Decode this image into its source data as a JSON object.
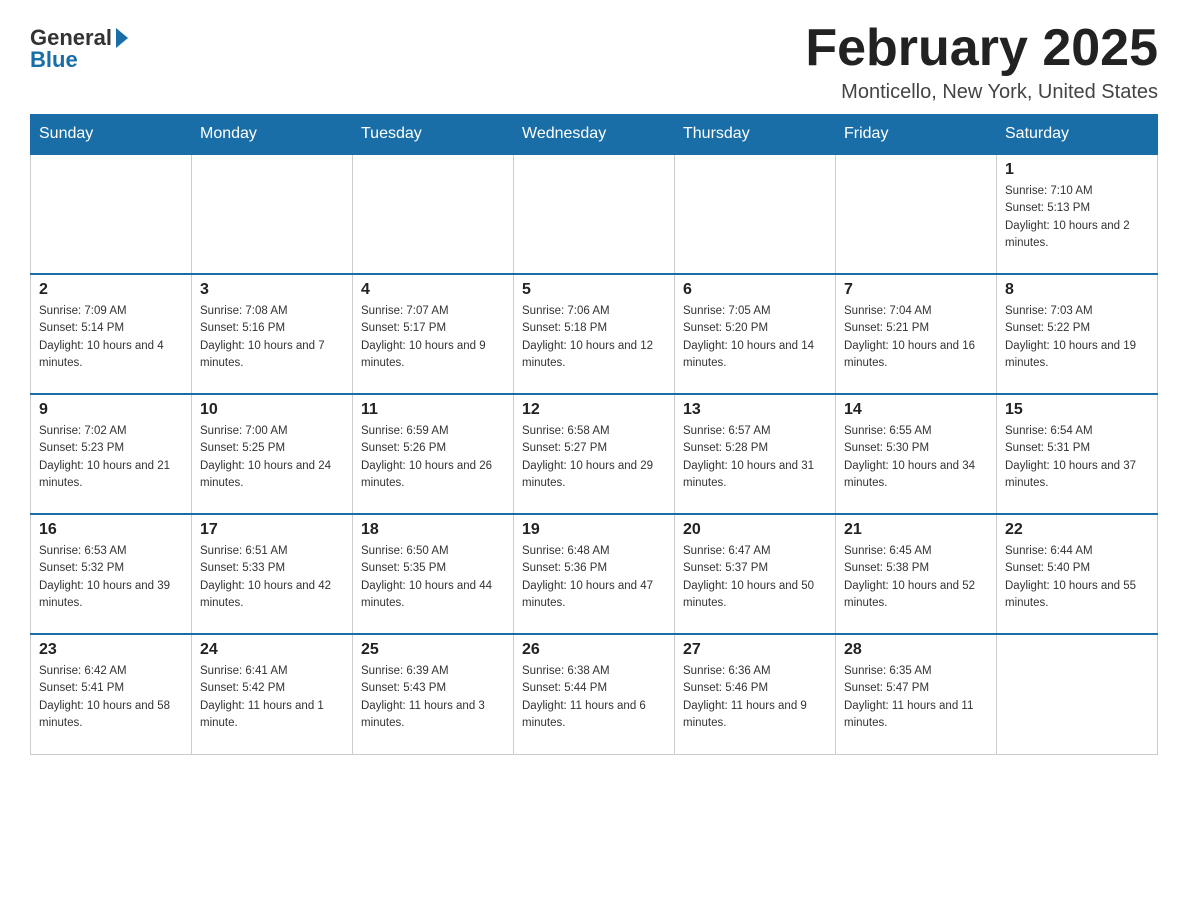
{
  "header": {
    "logo_general": "General",
    "logo_blue": "Blue",
    "title": "February 2025",
    "location": "Monticello, New York, United States"
  },
  "days_of_week": [
    "Sunday",
    "Monday",
    "Tuesday",
    "Wednesday",
    "Thursday",
    "Friday",
    "Saturday"
  ],
  "weeks": [
    [
      {
        "day": "",
        "sunrise": "",
        "sunset": "",
        "daylight": ""
      },
      {
        "day": "",
        "sunrise": "",
        "sunset": "",
        "daylight": ""
      },
      {
        "day": "",
        "sunrise": "",
        "sunset": "",
        "daylight": ""
      },
      {
        "day": "",
        "sunrise": "",
        "sunset": "",
        "daylight": ""
      },
      {
        "day": "",
        "sunrise": "",
        "sunset": "",
        "daylight": ""
      },
      {
        "day": "",
        "sunrise": "",
        "sunset": "",
        "daylight": ""
      },
      {
        "day": "1",
        "sunrise": "Sunrise: 7:10 AM",
        "sunset": "Sunset: 5:13 PM",
        "daylight": "Daylight: 10 hours and 2 minutes."
      }
    ],
    [
      {
        "day": "2",
        "sunrise": "Sunrise: 7:09 AM",
        "sunset": "Sunset: 5:14 PM",
        "daylight": "Daylight: 10 hours and 4 minutes."
      },
      {
        "day": "3",
        "sunrise": "Sunrise: 7:08 AM",
        "sunset": "Sunset: 5:16 PM",
        "daylight": "Daylight: 10 hours and 7 minutes."
      },
      {
        "day": "4",
        "sunrise": "Sunrise: 7:07 AM",
        "sunset": "Sunset: 5:17 PM",
        "daylight": "Daylight: 10 hours and 9 minutes."
      },
      {
        "day": "5",
        "sunrise": "Sunrise: 7:06 AM",
        "sunset": "Sunset: 5:18 PM",
        "daylight": "Daylight: 10 hours and 12 minutes."
      },
      {
        "day": "6",
        "sunrise": "Sunrise: 7:05 AM",
        "sunset": "Sunset: 5:20 PM",
        "daylight": "Daylight: 10 hours and 14 minutes."
      },
      {
        "day": "7",
        "sunrise": "Sunrise: 7:04 AM",
        "sunset": "Sunset: 5:21 PM",
        "daylight": "Daylight: 10 hours and 16 minutes."
      },
      {
        "day": "8",
        "sunrise": "Sunrise: 7:03 AM",
        "sunset": "Sunset: 5:22 PM",
        "daylight": "Daylight: 10 hours and 19 minutes."
      }
    ],
    [
      {
        "day": "9",
        "sunrise": "Sunrise: 7:02 AM",
        "sunset": "Sunset: 5:23 PM",
        "daylight": "Daylight: 10 hours and 21 minutes."
      },
      {
        "day": "10",
        "sunrise": "Sunrise: 7:00 AM",
        "sunset": "Sunset: 5:25 PM",
        "daylight": "Daylight: 10 hours and 24 minutes."
      },
      {
        "day": "11",
        "sunrise": "Sunrise: 6:59 AM",
        "sunset": "Sunset: 5:26 PM",
        "daylight": "Daylight: 10 hours and 26 minutes."
      },
      {
        "day": "12",
        "sunrise": "Sunrise: 6:58 AM",
        "sunset": "Sunset: 5:27 PM",
        "daylight": "Daylight: 10 hours and 29 minutes."
      },
      {
        "day": "13",
        "sunrise": "Sunrise: 6:57 AM",
        "sunset": "Sunset: 5:28 PM",
        "daylight": "Daylight: 10 hours and 31 minutes."
      },
      {
        "day": "14",
        "sunrise": "Sunrise: 6:55 AM",
        "sunset": "Sunset: 5:30 PM",
        "daylight": "Daylight: 10 hours and 34 minutes."
      },
      {
        "day": "15",
        "sunrise": "Sunrise: 6:54 AM",
        "sunset": "Sunset: 5:31 PM",
        "daylight": "Daylight: 10 hours and 37 minutes."
      }
    ],
    [
      {
        "day": "16",
        "sunrise": "Sunrise: 6:53 AM",
        "sunset": "Sunset: 5:32 PM",
        "daylight": "Daylight: 10 hours and 39 minutes."
      },
      {
        "day": "17",
        "sunrise": "Sunrise: 6:51 AM",
        "sunset": "Sunset: 5:33 PM",
        "daylight": "Daylight: 10 hours and 42 minutes."
      },
      {
        "day": "18",
        "sunrise": "Sunrise: 6:50 AM",
        "sunset": "Sunset: 5:35 PM",
        "daylight": "Daylight: 10 hours and 44 minutes."
      },
      {
        "day": "19",
        "sunrise": "Sunrise: 6:48 AM",
        "sunset": "Sunset: 5:36 PM",
        "daylight": "Daylight: 10 hours and 47 minutes."
      },
      {
        "day": "20",
        "sunrise": "Sunrise: 6:47 AM",
        "sunset": "Sunset: 5:37 PM",
        "daylight": "Daylight: 10 hours and 50 minutes."
      },
      {
        "day": "21",
        "sunrise": "Sunrise: 6:45 AM",
        "sunset": "Sunset: 5:38 PM",
        "daylight": "Daylight: 10 hours and 52 minutes."
      },
      {
        "day": "22",
        "sunrise": "Sunrise: 6:44 AM",
        "sunset": "Sunset: 5:40 PM",
        "daylight": "Daylight: 10 hours and 55 minutes."
      }
    ],
    [
      {
        "day": "23",
        "sunrise": "Sunrise: 6:42 AM",
        "sunset": "Sunset: 5:41 PM",
        "daylight": "Daylight: 10 hours and 58 minutes."
      },
      {
        "day": "24",
        "sunrise": "Sunrise: 6:41 AM",
        "sunset": "Sunset: 5:42 PM",
        "daylight": "Daylight: 11 hours and 1 minute."
      },
      {
        "day": "25",
        "sunrise": "Sunrise: 6:39 AM",
        "sunset": "Sunset: 5:43 PM",
        "daylight": "Daylight: 11 hours and 3 minutes."
      },
      {
        "day": "26",
        "sunrise": "Sunrise: 6:38 AM",
        "sunset": "Sunset: 5:44 PM",
        "daylight": "Daylight: 11 hours and 6 minutes."
      },
      {
        "day": "27",
        "sunrise": "Sunrise: 6:36 AM",
        "sunset": "Sunset: 5:46 PM",
        "daylight": "Daylight: 11 hours and 9 minutes."
      },
      {
        "day": "28",
        "sunrise": "Sunrise: 6:35 AM",
        "sunset": "Sunset: 5:47 PM",
        "daylight": "Daylight: 11 hours and 11 minutes."
      },
      {
        "day": "",
        "sunrise": "",
        "sunset": "",
        "daylight": ""
      }
    ]
  ]
}
